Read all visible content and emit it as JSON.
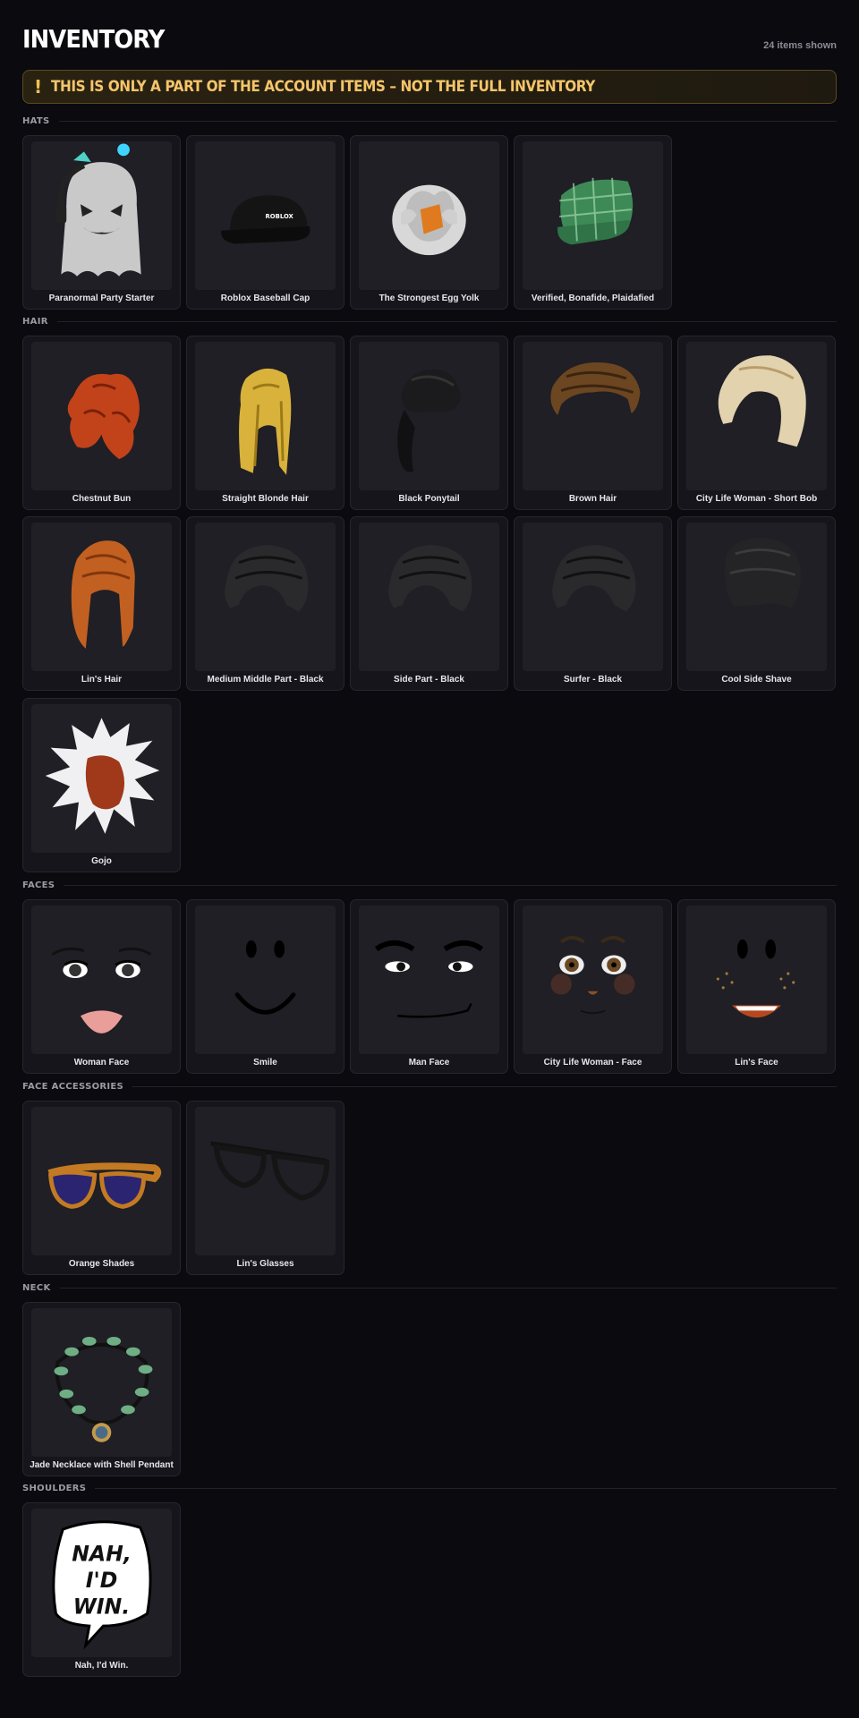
{
  "header": {
    "title": "INVENTORY",
    "count": "24 items shown"
  },
  "banner": {
    "icon": "!",
    "text": "THIS IS ONLY A PART OF THE ACCOUNT ITEMS – NOT THE FULL INVENTORY"
  },
  "sections": [
    {
      "label": "HATS",
      "items": [
        {
          "name": "Paranormal Party Starter",
          "icon": "ghost-hat-icon"
        },
        {
          "name": "Roblox Baseball Cap",
          "icon": "cap-icon"
        },
        {
          "name": "The Strongest Egg Yolk",
          "icon": "egg-yolk-icon"
        },
        {
          "name": "Verified, Bonafide, Plaidafied",
          "icon": "plaid-cap-icon"
        }
      ]
    },
    {
      "label": "HAIR",
      "items": [
        {
          "name": "Chestnut Bun",
          "icon": "hair-bun-icon"
        },
        {
          "name": "Straight Blonde Hair",
          "icon": "blonde-hair-icon"
        },
        {
          "name": "Black Ponytail",
          "icon": "ponytail-icon"
        },
        {
          "name": "Brown Hair",
          "icon": "brown-hair-icon"
        },
        {
          "name": "City Life Woman - Short Bob",
          "icon": "bob-hair-icon"
        },
        {
          "name": "Lin's Hair",
          "icon": "long-hair-icon"
        },
        {
          "name": "Medium Middle Part - Black",
          "icon": "black-hair-icon"
        },
        {
          "name": "Side Part - Black",
          "icon": "black-hair-icon"
        },
        {
          "name": "Surfer - Black",
          "icon": "black-hair-icon"
        },
        {
          "name": "Cool Side Shave",
          "icon": "shave-hair-icon"
        },
        {
          "name": "Gojo",
          "icon": "spiky-hair-icon"
        }
      ]
    },
    {
      "label": "FACES",
      "items": [
        {
          "name": "Woman Face",
          "icon": "woman-face-icon"
        },
        {
          "name": "Smile",
          "icon": "smile-face-icon"
        },
        {
          "name": "Man Face",
          "icon": "man-face-icon"
        },
        {
          "name": "City Life Woman - Face",
          "icon": "city-face-icon"
        },
        {
          "name": "Lin's Face",
          "icon": "lin-face-icon"
        }
      ]
    },
    {
      "label": "FACE ACCESSORIES",
      "items": [
        {
          "name": "Orange Shades",
          "icon": "sunglasses-icon"
        },
        {
          "name": "Lin's Glasses",
          "icon": "glasses-icon"
        }
      ]
    },
    {
      "label": "NECK",
      "items": [
        {
          "name": "Jade Necklace with Shell Pendant",
          "icon": "necklace-icon"
        }
      ]
    },
    {
      "label": "SHOULDERS",
      "items": [
        {
          "name": "Nah, I'd Win.",
          "icon": "speech-bubble-icon",
          "bubble_lines": [
            "NAH,",
            "I'D",
            "WIN."
          ]
        }
      ]
    }
  ]
}
